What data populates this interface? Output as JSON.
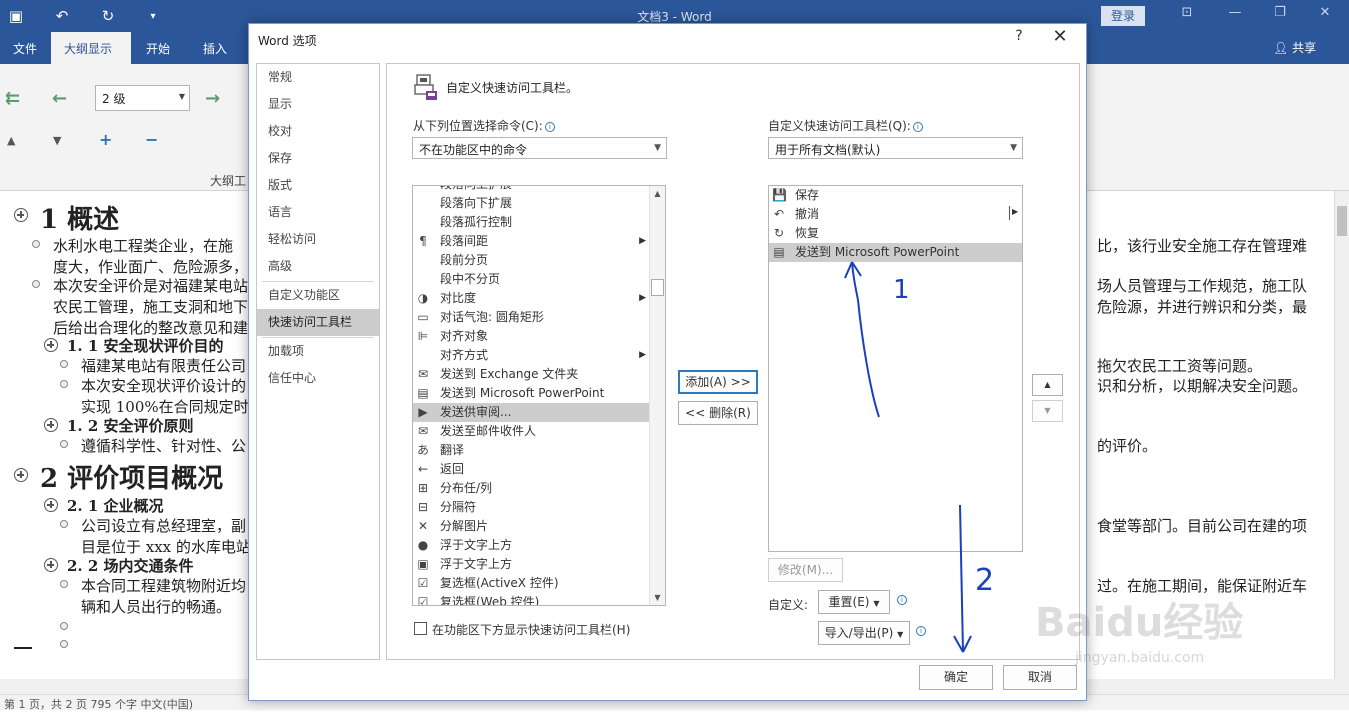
{
  "word": {
    "title": "文档3 - Word",
    "login_label": "登录",
    "share_label": "共享",
    "tabs": [
      "文件",
      "大纲显示",
      "开始",
      "插入"
    ],
    "outline_level": "2 级",
    "toolbar_group_label": "大纲工",
    "document": {
      "h1_1": "1  概述",
      "p1": "水利水电工程类企业，在施",
      "p1_r": "比，该行业安全施工存在管理难",
      "p1b": "度大，作业面广、危险源多，",
      "p2": "本次安全评价是对福建某电站",
      "p2_r": "场人员管理与工作规范，施工队",
      "p2b": "农民工管理，施工支洞和地下",
      "p2b_r": "危险源，并进行辨识和分类，最",
      "p2c": "后给出合理化的整改意见和建",
      "h2_1": "1. 1 安全现状评价目的",
      "p3": "福建某电站有限责任公司",
      "p3_r": "拖欠农民工工资等问题。",
      "p4": "本次安全现状评价设计的",
      "p4_r": "识和分析，以期解决安全问题。",
      "p4b": "实现 100%在合同规定时间",
      "h2_2": "1. 2 安全评价原则",
      "p5": "遵循科学性、针对性、公",
      "p5_r": "的评价。",
      "h1_2": "2  评价项目概况",
      "h2_3": "2. 1 企业概况",
      "p6": "公司设立有总经理室，副",
      "p6_r": "食堂等部门。目前公司在建的项",
      "p6b": "目是位于 xxx 的水库电站",
      "h2_4": "2. 2 场内交通条件",
      "p7": "本合同工程建筑物附近均",
      "p7_r": "过。在施工期间，能保证附近车",
      "p7b": "辆和人员出行的畅通。"
    },
    "status": "第 1 页，共 2 页     795 个字     中文(中国)"
  },
  "dialog": {
    "title": "Word 选项",
    "help": "?",
    "close": "✕",
    "nav_items": [
      "常规",
      "显示",
      "校对",
      "保存",
      "版式",
      "语言",
      "轻松访问",
      "高级",
      "自定义功能区",
      "快速访问工具栏",
      "加载项",
      "信任中心"
    ],
    "selected_nav": "快速访问工具栏",
    "heading": "自定义快速访问工具栏。",
    "from_label": "从下列位置选择命令(C):",
    "from_value": "不在功能区中的命令",
    "customize_label": "自定义快速访问工具栏(Q):",
    "customize_value": "用于所有文档(默认)",
    "commands": [
      {
        "label": "段落向上扩展",
        "icon": ""
      },
      {
        "label": "段落向下扩展",
        "icon": ""
      },
      {
        "label": "段落孤行控制",
        "icon": ""
      },
      {
        "label": "段落间距",
        "icon": "¶",
        "sub": true
      },
      {
        "label": "段前分页",
        "icon": ""
      },
      {
        "label": "段中不分页",
        "icon": ""
      },
      {
        "label": "对比度",
        "icon": "◑",
        "sub": true
      },
      {
        "label": "对话气泡: 圆角矩形",
        "icon": "▭"
      },
      {
        "label": "对齐对象",
        "icon": "⊫"
      },
      {
        "label": "对齐方式",
        "icon": "",
        "sub": true
      },
      {
        "label": "发送到 Exchange 文件夹",
        "icon": "✉"
      },
      {
        "label": "发送到 Microsoft PowerPoint",
        "icon": "▤"
      },
      {
        "label": "发送供审阅...",
        "icon": "▶"
      },
      {
        "label": "发送至邮件收件人",
        "icon": "✉"
      },
      {
        "label": "翻译",
        "icon": "あ"
      },
      {
        "label": "返回",
        "icon": "←"
      },
      {
        "label": "分布任/列",
        "icon": "⊞"
      },
      {
        "label": "分隔符",
        "icon": "⊟"
      },
      {
        "label": "分解图片",
        "icon": "✕"
      },
      {
        "label": "浮于文字上方",
        "icon": "●"
      },
      {
        "label": "浮于文字上方",
        "icon": "▣"
      },
      {
        "label": "复选框(ActiveX 控件)",
        "icon": "☑"
      },
      {
        "label": "复选框(Web 控件)",
        "icon": "☑"
      }
    ],
    "selected_command": "发送供审阅...",
    "qat_items": [
      {
        "label": "保存",
        "icon": "💾"
      },
      {
        "label": "撤消",
        "icon": "↶"
      },
      {
        "label": "恢复",
        "icon": "↻"
      },
      {
        "label": "发送到 Microsoft PowerPoint",
        "icon": "▤"
      }
    ],
    "add_label": "添加(A) >>",
    "remove_label": "<< 删除(R)",
    "modify_label": "修改(M)...",
    "customize_reset_label": "自定义:",
    "reset_label": "重置(E)",
    "import_export_label": "导入/导出(P)",
    "show_below_label": "在功能区下方显示快速访问工具栏(H)",
    "ok_label": "确定",
    "cancel_label": "取消"
  },
  "annotations": {
    "mark1": "1",
    "mark2": "2"
  },
  "watermark": {
    "main": "Baidu经验",
    "sub": "jingyan.baidu.com"
  },
  "colors": {
    "word_blue": "#2b579a",
    "annotation_blue": "#1a3fbf"
  }
}
